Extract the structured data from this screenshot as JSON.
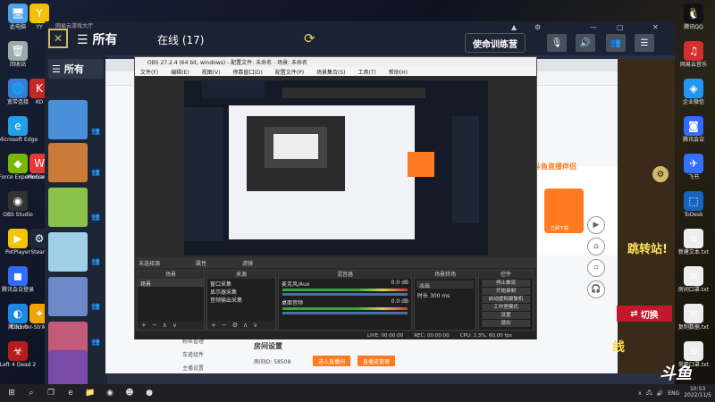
{
  "desktop_icons_left": [
    {
      "label": "此电脑",
      "icon": "computer-icon",
      "color": "#4aa3e8"
    },
    {
      "label": "回收站",
      "icon": "recycle-bin-icon",
      "color": "#9aa"
    },
    {
      "label": "宽带连接",
      "icon": "network-icon",
      "color": "#3a7bd5"
    },
    {
      "label": "Microsoft Edge",
      "icon": "edge-icon",
      "color": "#1fa0e8"
    },
    {
      "label": "GeForce Experience",
      "icon": "nvidia-icon",
      "color": "#76b900"
    },
    {
      "label": "OBS Studio",
      "icon": "obs-icon",
      "color": "#333"
    },
    {
      "label": "PotPlayer",
      "icon": "potplayer-icon",
      "color": "#f5c400"
    },
    {
      "label": "腾讯会议登录",
      "icon": "meeting-icon",
      "color": "#2f6bff"
    },
    {
      "label": "腾讯5.0",
      "icon": "qq-browser-icon",
      "color": "#1e88e5"
    },
    {
      "label": "Left 4 Dead 2",
      "icon": "l4d2-icon",
      "color": "#b71c1c"
    }
  ],
  "desktop_icons_col2": [
    {
      "label": "YY",
      "icon": "yy-icon",
      "color": "#f2c200"
    },
    {
      "label": "KO",
      "icon": "app-icon",
      "color": "#c62828"
    },
    {
      "label": "WeGame",
      "icon": "wegame-icon",
      "color": "#e53935"
    },
    {
      "label": "Steam",
      "icon": "steam-icon",
      "color": "#1b2838"
    },
    {
      "label": "Counter-Strike Global",
      "icon": "csgo-icon",
      "color": "#f0a500"
    }
  ],
  "desktop_icons_right": [
    {
      "label": "腾讯QQ",
      "icon": "qq-icon",
      "color": "#111"
    },
    {
      "label": "网易云音乐",
      "icon": "music-icon",
      "color": "#d32f2f"
    },
    {
      "label": "企业微信",
      "icon": "wecom-icon",
      "color": "#2196f3"
    },
    {
      "label": "腾讯会议",
      "icon": "tencent-meeting-icon",
      "color": "#2f6bff"
    },
    {
      "label": "飞书",
      "icon": "feishu-icon",
      "color": "#3370ff"
    },
    {
      "label": "ToDesk",
      "icon": "todesk-icon",
      "color": "#1565c0"
    },
    {
      "label": "新建文本.txt",
      "icon": "text-file-icon",
      "color": "#eee"
    },
    {
      "label": "房间口罩.txt",
      "icon": "text-file-icon",
      "color": "#eee"
    },
    {
      "label": "复制数据.txt",
      "icon": "text-file-icon",
      "color": "#eee"
    },
    {
      "label": "常用口罩.txt",
      "icon": "text-file-icon",
      "color": "#eee"
    }
  ],
  "chat_app": {
    "title": "网易云游戏大厅",
    "all_label": "所有",
    "online_label": "在线 (17)",
    "training_label": "使命训练营"
  },
  "browser": {
    "sidebar_items": [
      "粉丝管理",
      "车道组件",
      "主播设置"
    ],
    "room_title": "房间设置",
    "room_id": "房间ID: 58508",
    "btn_enter": "进入直播间",
    "btn_copy": "直播流管理",
    "promo_title": "斗鱼直播伴侣",
    "promo_btn": "立即下载"
  },
  "obs": {
    "title": "OBS 27.2.4 (64 bit, windows) - 配置文件: 未命名 - 场景: 未命名",
    "menu": [
      "文件(F)",
      "编辑(E)",
      "视图(V)",
      "停靠窗口(D)",
      "配置文件(P)",
      "场景集合(S)",
      "工具(T)",
      "帮助(H)"
    ],
    "scene_label": "未选择源",
    "props_label": "属性",
    "filter_label": "滤镜",
    "docks": {
      "scenes": {
        "title": "场景",
        "items": [
          "场景"
        ]
      },
      "sources": {
        "title": "来源",
        "items": [
          "窗口采集",
          "显示器采集",
          "音频输出采集"
        ]
      },
      "mixer": {
        "title": "混音器",
        "tracks": [
          {
            "name": "麦克风/Aux",
            "db": "0.0 dB"
          },
          {
            "name": "桌面音频",
            "db": "0.0 dB"
          }
        ]
      },
      "transitions": {
        "title": "场景转场",
        "mode": "淡出",
        "duration_label": "时长",
        "duration": "300 ms"
      },
      "controls": {
        "title": "控件",
        "buttons": [
          "停止推流",
          "开始录制",
          "启动虚拟摄像机",
          "工作室模式",
          "设置",
          "退出"
        ]
      }
    },
    "status": {
      "live": "LIVE: 00:00:00",
      "rec": "REC: 00:00:00",
      "cpu": "CPU: 2.3%, 60.00 fps"
    }
  },
  "right_strip": {
    "jump_text": "跳转站!",
    "switch_label": "切换",
    "xian_text": "线",
    "watermark": "斗鱼"
  },
  "taskbar": {
    "apps": [
      "start-icon",
      "search-icon",
      "task-view-icon",
      "edge-icon",
      "file-explorer-icon",
      "obs-icon",
      "chat-icon",
      "record-icon"
    ],
    "tray_lang": "ENG",
    "time": "10:53",
    "date": "2022/11/5"
  }
}
